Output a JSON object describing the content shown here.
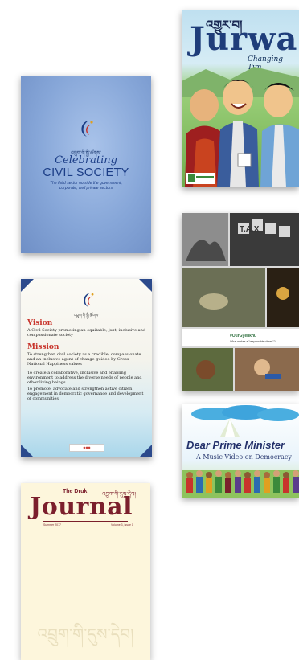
{
  "colors": {
    "civil_bg": "#86a6d8",
    "civil_text": "#1b3d86",
    "jurwa_title": "#1f3d7a",
    "mission_heading": "#c8342c",
    "journal_red": "#7b1f2c",
    "journal_bg": "#fdf6dc",
    "dear_pm_text": "#23306a"
  },
  "publications": {
    "civil_society": {
      "title_script": "Celebrating",
      "title": "CIVIL SOCIETY",
      "subtitle": "The third sector outside the government, corporate, and private sectors",
      "logo_caption": "འབྲུག་གི་སྤྱི་ཚོགས་",
      "logo_icon": "bhutan-crescent-logo"
    },
    "jurwa": {
      "tibetan_title": "འགྱུར་བ།",
      "title": "Jurwa",
      "subtitle": "Changing Tim",
      "illustration": "three-cartoon-men-illustration"
    },
    "vision_mission": {
      "logo_caption": "འབྲུག་གི་སྤྱི་ཚོགས་",
      "vision_heading": "Vision",
      "vision_text": "A Civil Society promoting an equitable, just, inclusive and compassionate society",
      "mission_heading": "Mission",
      "mission_items": [
        "To strengthen civil society as a credible, compassionate and an inclusive agent of change guided by Gross National Happiness values",
        "To create a collaborative, inclusive and enabling environment to address the diverse needs of people and other living beings",
        "To promote, advocate and strengthen active citizen engagement in democratic governance and development of communities"
      ],
      "footer_logo": "bhutan-media-logo"
    },
    "collage": {
      "tax_text": "T.A.X",
      "caption_title": "#OurGyenkhu",
      "caption_sub": "What makes a \"responsible citizen\"?"
    },
    "dear_prime_minister": {
      "title": "Dear Prime Minister",
      "subtitle": "A Music Video on Democracy"
    },
    "druk_journal": {
      "the": "The Druk",
      "tibetan_top": "འབྲུག་གི་དུས་དེབ།",
      "title": "Journal",
      "issue_left": "Summer 2017",
      "issue_right": "Volume 3, Issue 1",
      "tibetan_bottom": "འབྲུག་གི་དུས་དེབ།"
    }
  }
}
